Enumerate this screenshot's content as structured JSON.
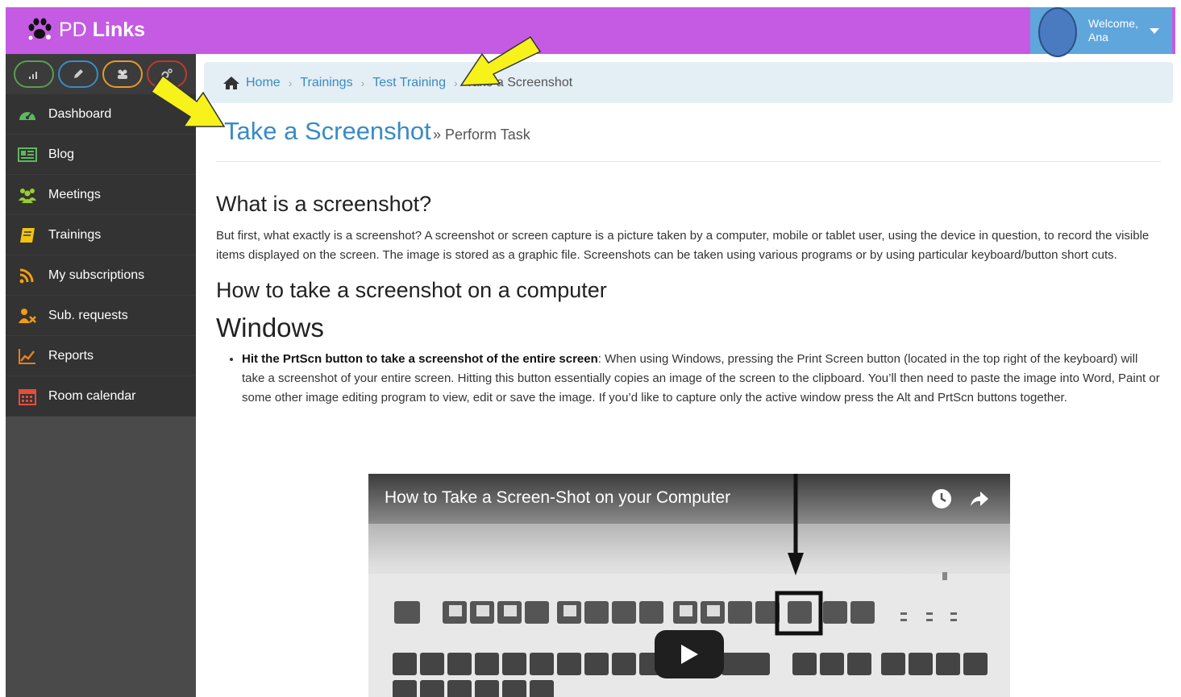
{
  "header": {
    "brand_pd": "PD",
    "brand_links": "Links",
    "welcome_line1": "Welcome,",
    "welcome_line2": "Ana"
  },
  "sidebar": {
    "quick_buttons": [
      {
        "icon": "signal-icon",
        "color": "#5a9e4c"
      },
      {
        "icon": "pencil-icon",
        "color": "#3a8bc4"
      },
      {
        "icon": "users-icon",
        "color": "#e59b2a"
      },
      {
        "icon": "settings-icon",
        "color": "#c0392b"
      }
    ],
    "items": [
      {
        "label": "Dashboard",
        "icon": "dashboard-icon",
        "color": "#5cb85c"
      },
      {
        "label": "Blog",
        "icon": "newspaper-icon",
        "color": "#5cb85c"
      },
      {
        "label": "Meetings",
        "icon": "group-icon",
        "color": "#9acd32"
      },
      {
        "label": "Trainings",
        "icon": "book-icon",
        "color": "#f1c40f"
      },
      {
        "label": "My subscriptions",
        "icon": "rss-icon",
        "color": "#f39c12"
      },
      {
        "label": "Sub. requests",
        "icon": "user-remove-icon",
        "color": "#f39c12"
      },
      {
        "label": "Reports",
        "icon": "chart-line-icon",
        "color": "#e67e22"
      },
      {
        "label": "Room calendar",
        "icon": "calendar-icon",
        "color": "#e74c3c"
      }
    ]
  },
  "breadcrumb": {
    "home": "Home",
    "trainings": "Trainings",
    "test_training": "Test Training",
    "current": "Take a Screenshot"
  },
  "page": {
    "title": "Take a Screenshot",
    "subtitle": "» Perform Task"
  },
  "content": {
    "h_what": "What is a screenshot?",
    "intro": "But first, what exactly is a screenshot? A screenshot or screen capture is a picture taken by a computer, mobile or tablet user, using the device in question, to record the visible items displayed on the screen. The image is stored as a graphic file. Screenshots can be taken using various programs or by using particular keyboard/button short cuts.",
    "h_how": "How to take a screenshot on a computer",
    "h_windows": "Windows",
    "step1_bold": "Hit the PrtScn button to take a screenshot of the entire screen",
    "step1_text": ": When using Windows, pressing the Print Screen button (located in the top right of the keyboard) will take a screenshot of your entire screen. Hitting this button essentially copies an image of the screen to the clipboard. You’ll then need to paste the image into Word, Paint or some other image editing program to view, edit or save the image. If you’d like to capture only the active window press the Alt and PrtScn buttons together."
  },
  "video": {
    "title": "How to Take a Screen-Shot on your Computer"
  },
  "colors": {
    "topbar": "#c45be2",
    "user_box": "#5fa6dc",
    "sidebar": "#333333",
    "link": "#3a8bc4",
    "arrow": "#f7f21a"
  }
}
